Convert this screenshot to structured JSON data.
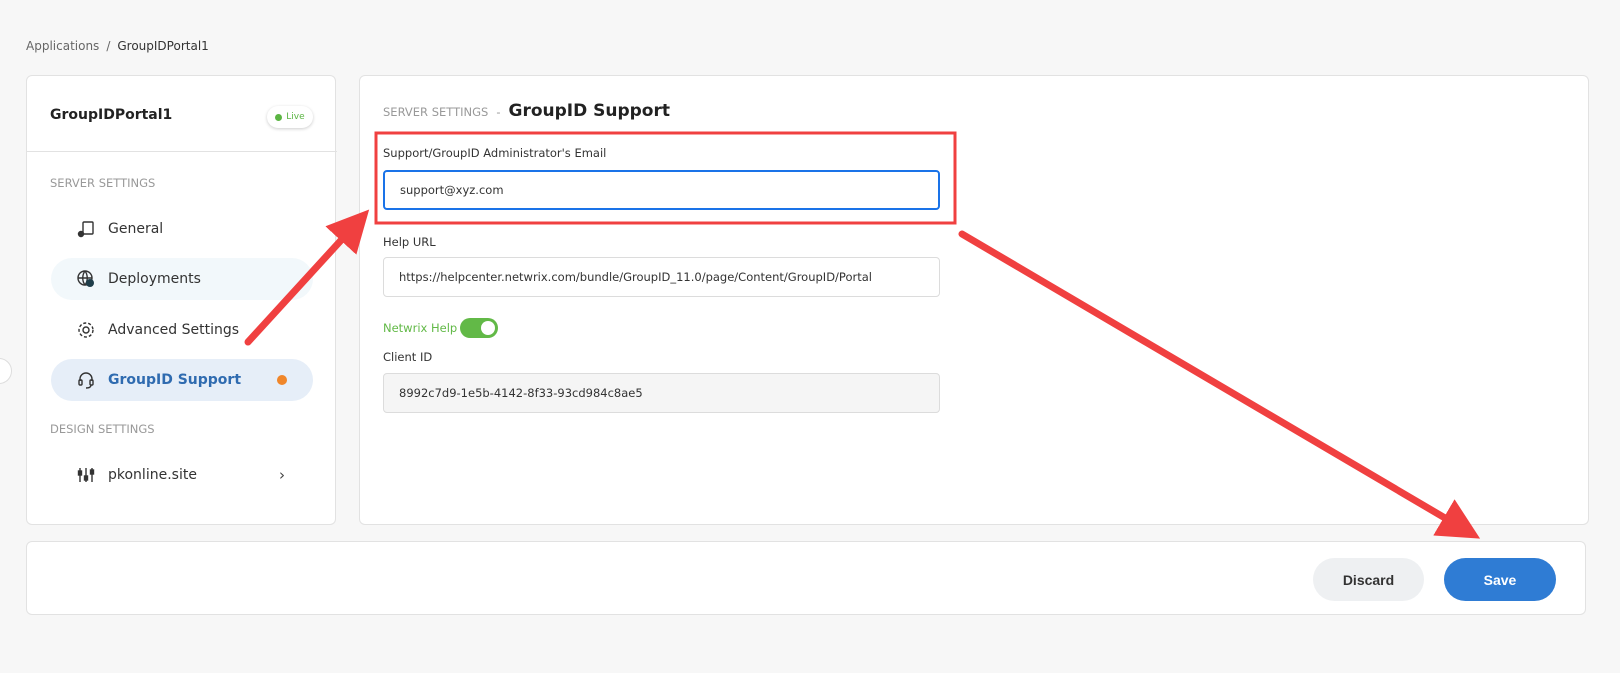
{
  "breadcrumb": {
    "items": [
      "Applications",
      "GroupIDPortal1"
    ],
    "separator": "/"
  },
  "sidebar": {
    "app_name": "GroupIDPortal1",
    "status": "Live",
    "server_settings_label": "SERVER SETTINGS",
    "design_settings_label": "DESIGN SETTINGS",
    "items": [
      {
        "label": "General",
        "icon": "general-settings-icon"
      },
      {
        "label": "Deployments",
        "icon": "globe-upload-icon"
      },
      {
        "label": "Advanced Settings",
        "icon": "gear-icon"
      },
      {
        "label": "GroupID Support",
        "icon": "headset-icon",
        "active": true
      },
      {
        "label": "pkonline.site",
        "icon": "sliders-icon"
      }
    ]
  },
  "main": {
    "section": "SERVER SETTINGS",
    "separator": "-",
    "title": "GroupID Support",
    "email_label": "Support/GroupID Administrator's Email",
    "email_value": "support@xyz.com",
    "help_url_label": "Help URL",
    "help_url_value": "https://helpcenter.netwrix.com/bundle/GroupID_11.0/page/Content/GroupID/Portal",
    "netwrix_help_label": "Netwrix Help",
    "netwrix_help_on": true,
    "client_id_label": "Client ID",
    "client_id_value": "8992c7d9-1e5b-4142-8f33-93cd984c8ae5"
  },
  "footer": {
    "discard": "Discard",
    "save": "Save"
  },
  "colors": {
    "accent": "#2f7cd4",
    "live": "#5bb543",
    "unsaved_dot": "#f0862a",
    "annotation": "#f04040"
  }
}
